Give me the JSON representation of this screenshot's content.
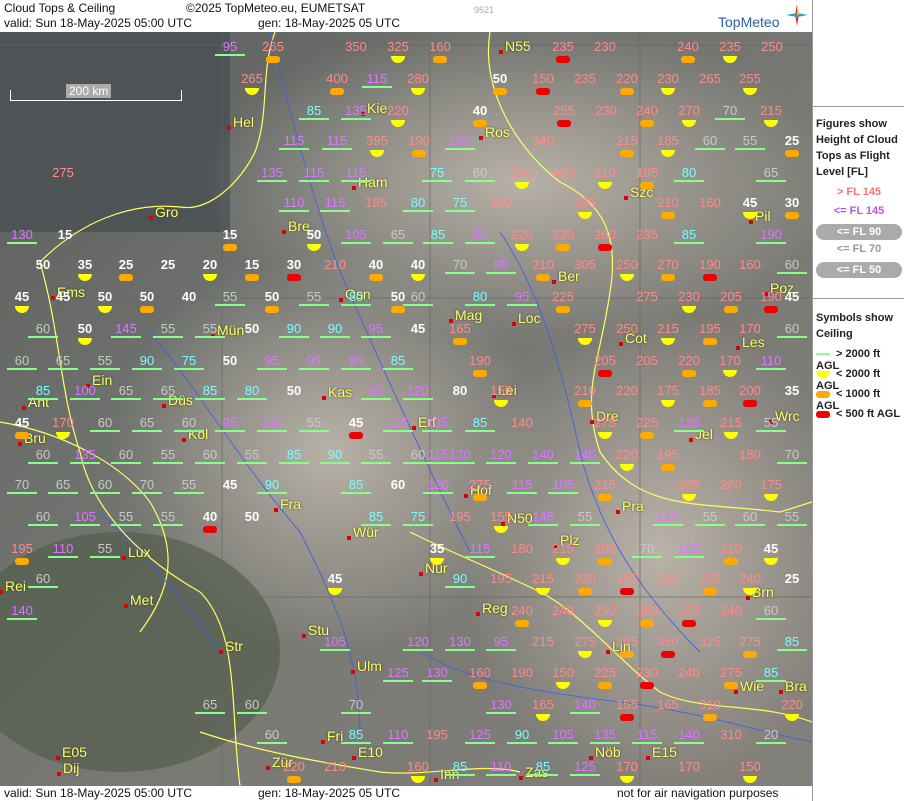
{
  "header": {
    "title": "Cloud Tops & Ceiling",
    "copyright": "©2025 TopMeteo.eu, EUMETSAT",
    "valid": "valid:  Sun  18-May-2025  05:00 UTC",
    "gen": "gen: 18-May-2025 05 UTC",
    "code": "9521",
    "brand": "TopMeteo"
  },
  "footer": {
    "valid": "valid:  Sun  18-May-2025  05:00 UTC",
    "gen": "gen: 18-May-2025 05 UTC",
    "disclaimer": "not for air navigation purposes"
  },
  "scale_bar": "200 km",
  "legend": {
    "tops_title": [
      "Figures show",
      "Height of Cloud",
      "Tops as Flight",
      "Level  [FL]"
    ],
    "tops_items": [
      {
        "label": "> FL 145",
        "color": "#ff7070"
      },
      {
        "label": "<= FL 145",
        "color": "#c050f0"
      },
      {
        "label": "<= FL 90",
        "color": "#ffffff"
      },
      {
        "label": "<= FL 70",
        "color": "#999999"
      },
      {
        "label": "<= FL 50",
        "color": "#ffffff"
      }
    ],
    "ceil_title": [
      "Symbols show",
      "Ceiling"
    ],
    "ceil_items": [
      {
        "label": "> 2000 ft AGL",
        "symbol": "line"
      },
      {
        "label": "< 2000 ft AGL",
        "symbol": "yellow"
      },
      {
        "label": "< 1000 ft AGL",
        "symbol": "orange"
      },
      {
        "label": "< 500 ft AGL",
        "symbol": "red"
      }
    ]
  },
  "cities": [
    "Hel",
    "Kie",
    "Ros",
    "Ham",
    "Szc",
    "Gro",
    "Bre",
    "Pil",
    "Ber",
    "Poz",
    "Ems",
    "Osn",
    "Mag",
    "Loc",
    "Mün",
    "Cot",
    "Les",
    "Ein",
    "Kas",
    "Lei",
    "Düs",
    "Ant",
    "Erf",
    "Wrc",
    "Köl",
    "Bru",
    "Dre",
    "Jel",
    "Hof",
    "Fra",
    "Pra",
    "N50",
    "Lux",
    "Wür",
    "Plz",
    "Nür",
    "Rei",
    "Met",
    "Reg",
    "Brn",
    "Stu",
    "Str",
    "Ulm",
    "Lin",
    "Wie",
    "Bra",
    "Fri",
    "E10",
    "Nöb",
    "E15",
    "E05",
    "Dij",
    "Zür",
    "Inn",
    "Zas",
    "N55"
  ],
  "values": [
    {
      "t": "95",
      "c": "m"
    },
    {
      "t": "265",
      "c": "p"
    },
    {
      "t": "350",
      "c": "p"
    },
    {
      "t": "325",
      "c": "p"
    },
    {
      "t": "160",
      "c": "p"
    },
    {
      "t": "235",
      "c": "p"
    },
    {
      "t": "230",
      "c": "p"
    },
    {
      "t": "240",
      "c": "p"
    },
    {
      "t": "235",
      "c": "p"
    },
    {
      "t": "250",
      "c": "p"
    },
    {
      "t": "265",
      "c": "p"
    },
    {
      "t": "400",
      "c": "p"
    },
    {
      "t": "115",
      "c": "m"
    },
    {
      "t": "280",
      "c": "p"
    },
    {
      "t": "50",
      "c": "w"
    },
    {
      "t": "150",
      "c": "p"
    },
    {
      "t": "235",
      "c": "p"
    },
    {
      "t": "220",
      "c": "p"
    },
    {
      "t": "230",
      "c": "p"
    },
    {
      "t": "265",
      "c": "p"
    },
    {
      "t": "255",
      "c": "p"
    },
    {
      "t": "85",
      "c": "c"
    },
    {
      "t": "135",
      "c": "m"
    },
    {
      "t": "220",
      "c": "p"
    },
    {
      "t": "40",
      "c": "w"
    },
    {
      "t": "255",
      "c": "p"
    },
    {
      "t": "230",
      "c": "p"
    },
    {
      "t": "240",
      "c": "p"
    },
    {
      "t": "270",
      "c": "p"
    },
    {
      "t": "70",
      "c": "g"
    },
    {
      "t": "215",
      "c": "p"
    },
    {
      "t": "115",
      "c": "m"
    },
    {
      "t": "115",
      "c": "m"
    },
    {
      "t": "395",
      "c": "p"
    },
    {
      "t": "190",
      "c": "p"
    },
    {
      "t": "135",
      "c": "m"
    },
    {
      "t": "340",
      "c": "p"
    },
    {
      "t": "215",
      "c": "p"
    },
    {
      "t": "185",
      "c": "p"
    },
    {
      "t": "60",
      "c": "g"
    },
    {
      "t": "55",
      "c": "g"
    },
    {
      "t": "25",
      "c": "w"
    },
    {
      "t": "275",
      "c": "p"
    },
    {
      "t": "135",
      "c": "m"
    },
    {
      "t": "115",
      "c": "m"
    },
    {
      "t": "115",
      "c": "m"
    },
    {
      "t": "75",
      "c": "c"
    },
    {
      "t": "60",
      "c": "g"
    },
    {
      "t": "240",
      "c": "p"
    },
    {
      "t": "400",
      "c": "p"
    },
    {
      "t": "210",
      "c": "p"
    },
    {
      "t": "185",
      "c": "p"
    },
    {
      "t": "80",
      "c": "c"
    },
    {
      "t": "65",
      "c": "g"
    },
    {
      "t": "110",
      "c": "m"
    },
    {
      "t": "115",
      "c": "m"
    },
    {
      "t": "185",
      "c": "p"
    },
    {
      "t": "80",
      "c": "c"
    },
    {
      "t": "75",
      "c": "c"
    },
    {
      "t": "260",
      "c": "p"
    },
    {
      "t": "235",
      "c": "p"
    },
    {
      "t": "210",
      "c": "p"
    },
    {
      "t": "160",
      "c": "p"
    },
    {
      "t": "45",
      "c": "w"
    },
    {
      "t": "30",
      "c": "w"
    },
    {
      "t": "130",
      "c": "m"
    },
    {
      "t": "15",
      "c": "w"
    },
    {
      "t": "15",
      "c": "w"
    },
    {
      "t": "50",
      "c": "w"
    },
    {
      "t": "105",
      "c": "m"
    },
    {
      "t": "65",
      "c": "g"
    },
    {
      "t": "85",
      "c": "c"
    },
    {
      "t": "95",
      "c": "m"
    },
    {
      "t": "220",
      "c": "p"
    },
    {
      "t": "330",
      "c": "p"
    },
    {
      "t": "260",
      "c": "p"
    },
    {
      "t": "235",
      "c": "p"
    },
    {
      "t": "85",
      "c": "c"
    },
    {
      "t": "190",
      "c": "m"
    },
    {
      "t": "50",
      "c": "w"
    },
    {
      "t": "35",
      "c": "w"
    },
    {
      "t": "25",
      "c": "w"
    },
    {
      "t": "25",
      "c": "w"
    },
    {
      "t": "20",
      "c": "w"
    },
    {
      "t": "15",
      "c": "w"
    },
    {
      "t": "30",
      "c": "w"
    },
    {
      "t": "210",
      "c": "p"
    },
    {
      "t": "40",
      "c": "w"
    },
    {
      "t": "40",
      "c": "w"
    },
    {
      "t": "70",
      "c": "g"
    },
    {
      "t": "95",
      "c": "m"
    },
    {
      "t": "210",
      "c": "p"
    },
    {
      "t": "305",
      "c": "p"
    },
    {
      "t": "250",
      "c": "p"
    },
    {
      "t": "270",
      "c": "p"
    },
    {
      "t": "190",
      "c": "p"
    },
    {
      "t": "160",
      "c": "p"
    },
    {
      "t": "60",
      "c": "g"
    },
    {
      "t": "45",
      "c": "w"
    },
    {
      "t": "45",
      "c": "w"
    },
    {
      "t": "50",
      "c": "w"
    },
    {
      "t": "50",
      "c": "w"
    },
    {
      "t": "40",
      "c": "w"
    },
    {
      "t": "55",
      "c": "g"
    },
    {
      "t": "50",
      "c": "w"
    },
    {
      "t": "55",
      "c": "g"
    },
    {
      "t": "80",
      "c": "c"
    },
    {
      "t": "50",
      "c": "w"
    },
    {
      "t": "60",
      "c": "g"
    },
    {
      "t": "80",
      "c": "c"
    },
    {
      "t": "95",
      "c": "m"
    },
    {
      "t": "225",
      "c": "p"
    },
    {
      "t": "275",
      "c": "p"
    },
    {
      "t": "230",
      "c": "p"
    },
    {
      "t": "205",
      "c": "p"
    },
    {
      "t": "190",
      "c": "p"
    },
    {
      "t": "45",
      "c": "w"
    },
    {
      "t": "60",
      "c": "g"
    },
    {
      "t": "50",
      "c": "w"
    },
    {
      "t": "145",
      "c": "m"
    },
    {
      "t": "55",
      "c": "g"
    },
    {
      "t": "55",
      "c": "g"
    },
    {
      "t": "50",
      "c": "w"
    },
    {
      "t": "90",
      "c": "c"
    },
    {
      "t": "90",
      "c": "c"
    },
    {
      "t": "95",
      "c": "m"
    },
    {
      "t": "45",
      "c": "w"
    },
    {
      "t": "165",
      "c": "p"
    },
    {
      "t": "275",
      "c": "p"
    },
    {
      "t": "250",
      "c": "p"
    },
    {
      "t": "215",
      "c": "p"
    },
    {
      "t": "195",
      "c": "p"
    },
    {
      "t": "170",
      "c": "p"
    },
    {
      "t": "60",
      "c": "g"
    },
    {
      "t": "60",
      "c": "g"
    },
    {
      "t": "65",
      "c": "g"
    },
    {
      "t": "55",
      "c": "g"
    },
    {
      "t": "90",
      "c": "c"
    },
    {
      "t": "75",
      "c": "c"
    },
    {
      "t": "50",
      "c": "w"
    },
    {
      "t": "95",
      "c": "m"
    },
    {
      "t": "95",
      "c": "m"
    },
    {
      "t": "95",
      "c": "m"
    },
    {
      "t": "85",
      "c": "c"
    },
    {
      "t": "190",
      "c": "p"
    },
    {
      "t": "205",
      "c": "p"
    },
    {
      "t": "205",
      "c": "p"
    },
    {
      "t": "220",
      "c": "p"
    },
    {
      "t": "170",
      "c": "p"
    },
    {
      "t": "110",
      "c": "m"
    },
    {
      "t": "85",
      "c": "c"
    },
    {
      "t": "100",
      "c": "m"
    },
    {
      "t": "65",
      "c": "g"
    },
    {
      "t": "65",
      "c": "g"
    },
    {
      "t": "85",
      "c": "c"
    },
    {
      "t": "80",
      "c": "c"
    },
    {
      "t": "50",
      "c": "w"
    },
    {
      "t": "95",
      "c": "m"
    },
    {
      "t": "120",
      "c": "m"
    },
    {
      "t": "80",
      "c": "w"
    },
    {
      "t": "155",
      "c": "p"
    },
    {
      "t": "210",
      "c": "p"
    },
    {
      "t": "220",
      "c": "p"
    },
    {
      "t": "175",
      "c": "p"
    },
    {
      "t": "185",
      "c": "p"
    },
    {
      "t": "200",
      "c": "p"
    },
    {
      "t": "35",
      "c": "w"
    },
    {
      "t": "45",
      "c": "w"
    },
    {
      "t": "170",
      "c": "p"
    },
    {
      "t": "60",
      "c": "g"
    },
    {
      "t": "65",
      "c": "g"
    },
    {
      "t": "60",
      "c": "g"
    },
    {
      "t": "95",
      "c": "m"
    },
    {
      "t": "100",
      "c": "m"
    },
    {
      "t": "55",
      "c": "g"
    },
    {
      "t": "45",
      "c": "w"
    },
    {
      "t": "115",
      "c": "m"
    },
    {
      "t": "135",
      "c": "m"
    },
    {
      "t": "85",
      "c": "c"
    },
    {
      "t": "140",
      "c": "p"
    },
    {
      "t": "275",
      "c": "p"
    },
    {
      "t": "225",
      "c": "p"
    },
    {
      "t": "135",
      "c": "m"
    },
    {
      "t": "215",
      "c": "p"
    },
    {
      "t": "55",
      "c": "g"
    },
    {
      "t": "60",
      "c": "g"
    },
    {
      "t": "135",
      "c": "m"
    },
    {
      "t": "60",
      "c": "g"
    },
    {
      "t": "55",
      "c": "g"
    },
    {
      "t": "60",
      "c": "g"
    },
    {
      "t": "55",
      "c": "g"
    },
    {
      "t": "85",
      "c": "c"
    },
    {
      "t": "90",
      "c": "c"
    },
    {
      "t": "55",
      "c": "g"
    },
    {
      "t": "60",
      "c": "g"
    },
    {
      "t": "115",
      "c": "m"
    },
    {
      "t": "130",
      "c": "m"
    },
    {
      "t": "120",
      "c": "m"
    },
    {
      "t": "140",
      "c": "m"
    },
    {
      "t": "145",
      "c": "m"
    },
    {
      "t": "220",
      "c": "p"
    },
    {
      "t": "195",
      "c": "p"
    },
    {
      "t": "180",
      "c": "p"
    },
    {
      "t": "70",
      "c": "g"
    },
    {
      "t": "70",
      "c": "g"
    },
    {
      "t": "65",
      "c": "g"
    },
    {
      "t": "60",
      "c": "g"
    },
    {
      "t": "70",
      "c": "g"
    },
    {
      "t": "55",
      "c": "g"
    },
    {
      "t": "45",
      "c": "w"
    },
    {
      "t": "90",
      "c": "c"
    },
    {
      "t": "85",
      "c": "c"
    },
    {
      "t": "60",
      "c": "w"
    },
    {
      "t": "120",
      "c": "m"
    },
    {
      "t": "275",
      "c": "p"
    },
    {
      "t": "115",
      "c": "m"
    },
    {
      "t": "105",
      "c": "m"
    },
    {
      "t": "215",
      "c": "p"
    },
    {
      "t": "225",
      "c": "p"
    },
    {
      "t": "280",
      "c": "p"
    },
    {
      "t": "175",
      "c": "p"
    },
    {
      "t": "60",
      "c": "g"
    },
    {
      "t": "105",
      "c": "m"
    },
    {
      "t": "55",
      "c": "g"
    },
    {
      "t": "55",
      "c": "g"
    },
    {
      "t": "40",
      "c": "w"
    },
    {
      "t": "50",
      "c": "w"
    },
    {
      "t": "85",
      "c": "c"
    },
    {
      "t": "75",
      "c": "c"
    },
    {
      "t": "195",
      "c": "p"
    },
    {
      "t": "155",
      "c": "p"
    },
    {
      "t": "145",
      "c": "m"
    },
    {
      "t": "55",
      "c": "g"
    },
    {
      "t": "145",
      "c": "m"
    },
    {
      "t": "55",
      "c": "g"
    },
    {
      "t": "60",
      "c": "g"
    },
    {
      "t": "55",
      "c": "g"
    },
    {
      "t": "195",
      "c": "p"
    },
    {
      "t": "110",
      "c": "m"
    },
    {
      "t": "55",
      "c": "g"
    },
    {
      "t": "35",
      "c": "w"
    },
    {
      "t": "115",
      "c": "m"
    },
    {
      "t": "180",
      "c": "p"
    },
    {
      "t": "215",
      "c": "p"
    },
    {
      "t": "205",
      "c": "p"
    },
    {
      "t": "70",
      "c": "g"
    },
    {
      "t": "105",
      "c": "m"
    },
    {
      "t": "210",
      "c": "p"
    },
    {
      "t": "45",
      "c": "w"
    },
    {
      "t": "60",
      "c": "g"
    },
    {
      "t": "45",
      "c": "w"
    },
    {
      "t": "90",
      "c": "c"
    },
    {
      "t": "195",
      "c": "p"
    },
    {
      "t": "215",
      "c": "p"
    },
    {
      "t": "230",
      "c": "p"
    },
    {
      "t": "195",
      "c": "p"
    },
    {
      "t": "180",
      "c": "p"
    },
    {
      "t": "235",
      "c": "p"
    },
    {
      "t": "240",
      "c": "p"
    },
    {
      "t": "25",
      "c": "w"
    },
    {
      "t": "140",
      "c": "m"
    },
    {
      "t": "240",
      "c": "p"
    },
    {
      "t": "240",
      "c": "p"
    },
    {
      "t": "290",
      "c": "p"
    },
    {
      "t": "240",
      "c": "p"
    },
    {
      "t": "155",
      "c": "p"
    },
    {
      "t": "240",
      "c": "p"
    },
    {
      "t": "60",
      "c": "g"
    },
    {
      "t": "105",
      "c": "m"
    },
    {
      "t": "120",
      "c": "m"
    },
    {
      "t": "130",
      "c": "m"
    },
    {
      "t": "95",
      "c": "m"
    },
    {
      "t": "215",
      "c": "p"
    },
    {
      "t": "275",
      "c": "p"
    },
    {
      "t": "265",
      "c": "p"
    },
    {
      "t": "350",
      "c": "p"
    },
    {
      "t": "325",
      "c": "p"
    },
    {
      "t": "275",
      "c": "p"
    },
    {
      "t": "85",
      "c": "c"
    },
    {
      "t": "125",
      "c": "m"
    },
    {
      "t": "130",
      "c": "m"
    },
    {
      "t": "160",
      "c": "p"
    },
    {
      "t": "190",
      "c": "p"
    },
    {
      "t": "150",
      "c": "p"
    },
    {
      "t": "225",
      "c": "p"
    },
    {
      "t": "230",
      "c": "p"
    },
    {
      "t": "240",
      "c": "p"
    },
    {
      "t": "275",
      "c": "p"
    },
    {
      "t": "85",
      "c": "c"
    },
    {
      "t": "65",
      "c": "g"
    },
    {
      "t": "60",
      "c": "g"
    },
    {
      "t": "70",
      "c": "g"
    },
    {
      "t": "130",
      "c": "m"
    },
    {
      "t": "165",
      "c": "p"
    },
    {
      "t": "140",
      "c": "m"
    },
    {
      "t": "155",
      "c": "p"
    },
    {
      "t": "165",
      "c": "p"
    },
    {
      "t": "310",
      "c": "p"
    },
    {
      "t": "220",
      "c": "p"
    },
    {
      "t": "60",
      "c": "g"
    },
    {
      "t": "85",
      "c": "c"
    },
    {
      "t": "110",
      "c": "m"
    },
    {
      "t": "195",
      "c": "p"
    },
    {
      "t": "125",
      "c": "m"
    },
    {
      "t": "90",
      "c": "c"
    },
    {
      "t": "105",
      "c": "m"
    },
    {
      "t": "135",
      "c": "m"
    },
    {
      "t": "115",
      "c": "m"
    },
    {
      "t": "140",
      "c": "m"
    },
    {
      "t": "310",
      "c": "p"
    },
    {
      "t": "20",
      "c": "g"
    },
    {
      "t": "220",
      "c": "p"
    },
    {
      "t": "210",
      "c": "p"
    },
    {
      "t": "160",
      "c": "p"
    },
    {
      "t": "85",
      "c": "c"
    },
    {
      "t": "110",
      "c": "m"
    },
    {
      "t": "85",
      "c": "c"
    },
    {
      "t": "125",
      "c": "m"
    },
    {
      "t": "170",
      "c": "p"
    },
    {
      "t": "170",
      "c": "p"
    },
    {
      "t": "150",
      "c": "p"
    }
  ]
}
